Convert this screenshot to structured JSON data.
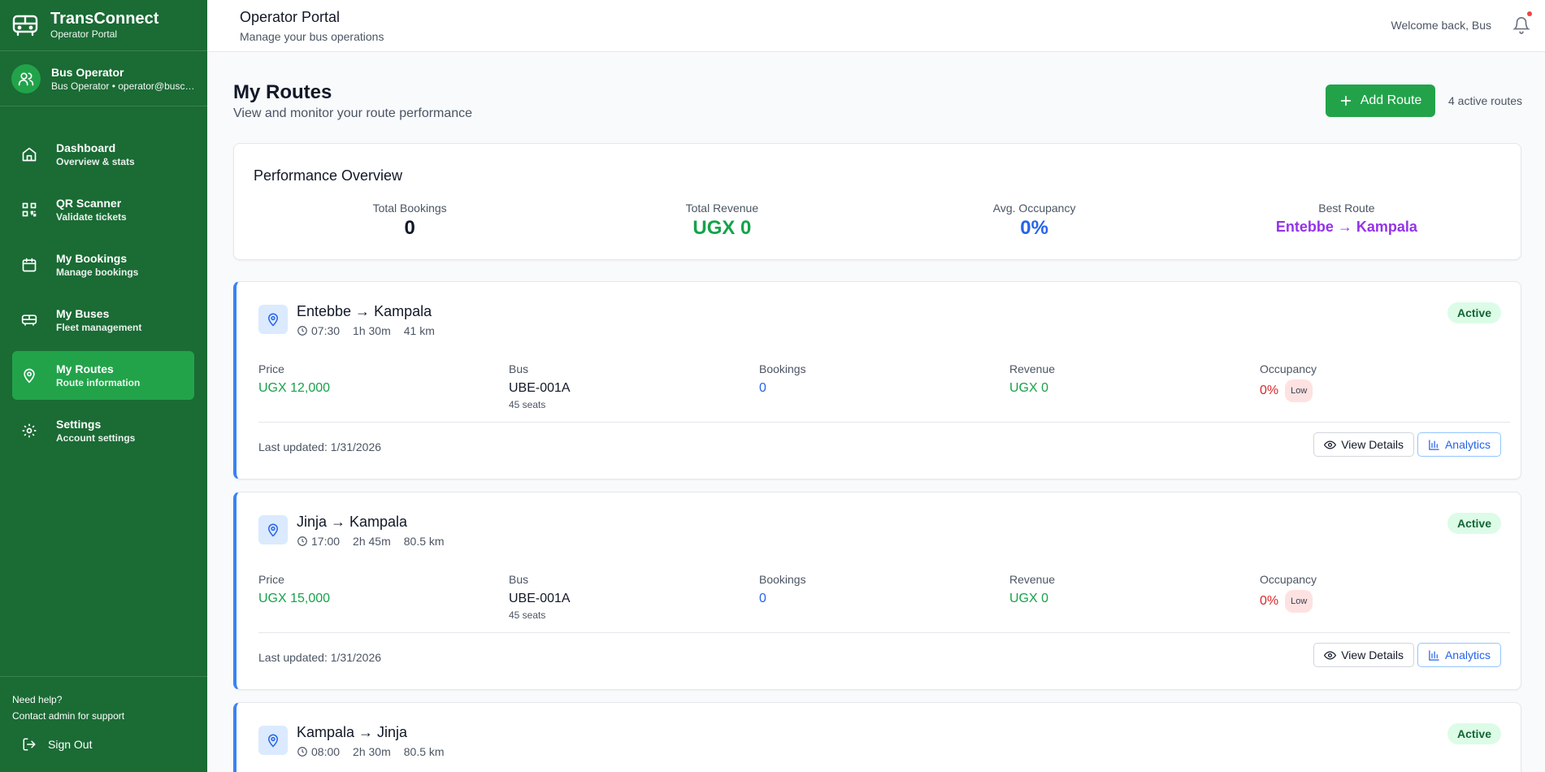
{
  "brand": {
    "title": "TransConnect",
    "subtitle": "Operator Portal"
  },
  "user": {
    "name": "Bus Operator",
    "meta": "Bus Operator • operator@buscompany.com"
  },
  "nav": [
    {
      "label": "Dashboard",
      "sub": "Overview & stats",
      "icon": "home-icon"
    },
    {
      "label": "QR Scanner",
      "sub": "Validate tickets",
      "icon": "qr-icon"
    },
    {
      "label": "My Bookings",
      "sub": "Manage bookings",
      "icon": "calendar-icon"
    },
    {
      "label": "My Buses",
      "sub": "Fleet management",
      "icon": "bus-icon"
    },
    {
      "label": "My Routes",
      "sub": "Route information",
      "icon": "map-pin-icon",
      "active": true
    },
    {
      "label": "Settings",
      "sub": "Account settings",
      "icon": "gear-icon"
    }
  ],
  "help": {
    "title": "Need help?",
    "sub": "Contact admin for support",
    "signout": "Sign Out"
  },
  "header": {
    "title": "Operator Portal",
    "subtitle": "Manage your bus operations",
    "welcome": "Welcome back, Bus"
  },
  "page": {
    "title": "My Routes",
    "subtitle": "View and monitor your route performance",
    "add_label": "Add Route",
    "active_count": "4 active routes"
  },
  "performance": {
    "title": "Performance Overview",
    "total_bookings_label": "Total Bookings",
    "total_bookings": "0",
    "total_revenue_label": "Total Revenue",
    "total_revenue": "UGX 0",
    "avg_occupancy_label": "Avg. Occupancy",
    "avg_occupancy": "0%",
    "best_route_label": "Best Route",
    "best_route": "Entebbe → Kampala"
  },
  "labels": {
    "price": "Price",
    "bus": "Bus",
    "bookings": "Bookings",
    "revenue": "Revenue",
    "occupancy": "Occupancy",
    "view_details": "View Details",
    "analytics": "Analytics",
    "active": "Active",
    "low": "Low"
  },
  "routes": [
    {
      "name": "Entebbe → Kampala",
      "time": "07:30",
      "duration": "1h 30m",
      "distance": "41 km",
      "price": "UGX 12,000",
      "bus": "UBE-001A",
      "seats": "45 seats",
      "bookings": "0",
      "revenue": "UGX 0",
      "occupancy": "0%",
      "updated": "Last updated: 1/31/2026"
    },
    {
      "name": "Jinja → Kampala",
      "time": "17:00",
      "duration": "2h 45m",
      "distance": "80.5 km",
      "price": "UGX 15,000",
      "bus": "UBE-001A",
      "seats": "45 seats",
      "bookings": "0",
      "revenue": "UGX 0",
      "occupancy": "0%",
      "updated": "Last updated: 1/31/2026"
    },
    {
      "name": "Kampala → Jinja",
      "time": "08:00",
      "duration": "2h 30m",
      "distance": "80.5 km"
    }
  ],
  "colors": {
    "sidebar": "#1a6b34",
    "accent": "#22a34a",
    "blue": "#2563eb",
    "purple": "#9333ea",
    "red": "#dc2626"
  }
}
